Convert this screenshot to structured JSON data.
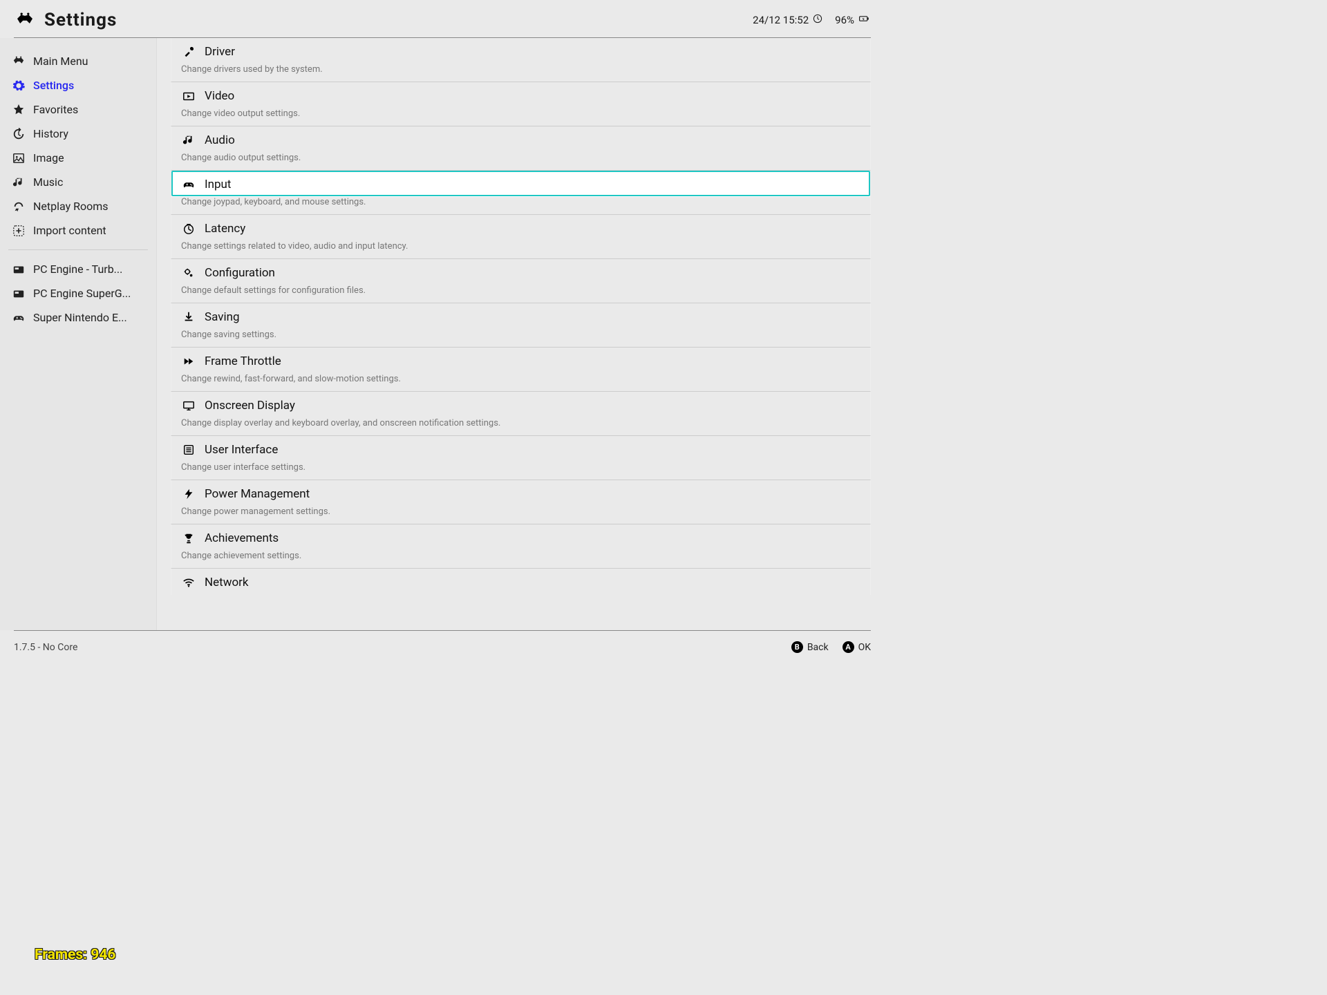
{
  "header": {
    "title": "Settings",
    "datetime": "24/12 15:52",
    "battery_percent": "96%"
  },
  "sidebar": {
    "items": [
      {
        "label": "Main Menu",
        "icon": "retroarch-icon"
      },
      {
        "label": "Settings",
        "icon": "cog-icon",
        "selected": true
      },
      {
        "label": "Favorites",
        "icon": "star-icon"
      },
      {
        "label": "History",
        "icon": "history-icon"
      },
      {
        "label": "Image",
        "icon": "image-icon"
      },
      {
        "label": "Music",
        "icon": "music-icon"
      },
      {
        "label": "Netplay Rooms",
        "icon": "netplay-icon"
      },
      {
        "label": "Import content",
        "icon": "plus-box-icon"
      }
    ],
    "playlists": [
      {
        "label": "PC Engine - Turb...",
        "icon": "card-icon"
      },
      {
        "label": "PC Engine SuperG...",
        "icon": "card-icon"
      },
      {
        "label": "Super Nintendo E...",
        "icon": "gamepad-icon"
      }
    ]
  },
  "settings": [
    {
      "label": "Driver",
      "desc": "Change drivers used by the system.",
      "icon": "tools-icon"
    },
    {
      "label": "Video",
      "desc": "Change video output settings.",
      "icon": "video-icon"
    },
    {
      "label": "Audio",
      "desc": "Change audio output settings.",
      "icon": "audio-icon"
    },
    {
      "label": "Input",
      "desc": "Change joypad, keyboard, and mouse settings.",
      "icon": "gamepad-icon",
      "focused": true
    },
    {
      "label": "Latency",
      "desc": "Change settings related to video, audio and input latency.",
      "icon": "latency-icon"
    },
    {
      "label": "Configuration",
      "desc": "Change default settings for configuration files.",
      "icon": "config-icon"
    },
    {
      "label": "Saving",
      "desc": "Change saving settings.",
      "icon": "save-icon"
    },
    {
      "label": "Frame Throttle",
      "desc": "Change rewind, fast-forward, and slow-motion settings.",
      "icon": "fastforward-icon"
    },
    {
      "label": "Onscreen Display",
      "desc": "Change display overlay and keyboard overlay, and onscreen notification settings.",
      "icon": "display-icon"
    },
    {
      "label": "User Interface",
      "desc": "Change user interface settings.",
      "icon": "list-icon"
    },
    {
      "label": "Power Management",
      "desc": "Change power management settings.",
      "icon": "bolt-icon"
    },
    {
      "label": "Achievements",
      "desc": "Change achievement settings.",
      "icon": "trophy-icon"
    },
    {
      "label": "Network",
      "desc": "",
      "icon": "wifi-icon"
    }
  ],
  "footer": {
    "version_text": "1.7.5 - No Core",
    "hint_back": {
      "key": "B",
      "label": "Back"
    },
    "hint_ok": {
      "key": "A",
      "label": "OK"
    }
  },
  "overlay": {
    "frames_label": "Frames: 946"
  }
}
